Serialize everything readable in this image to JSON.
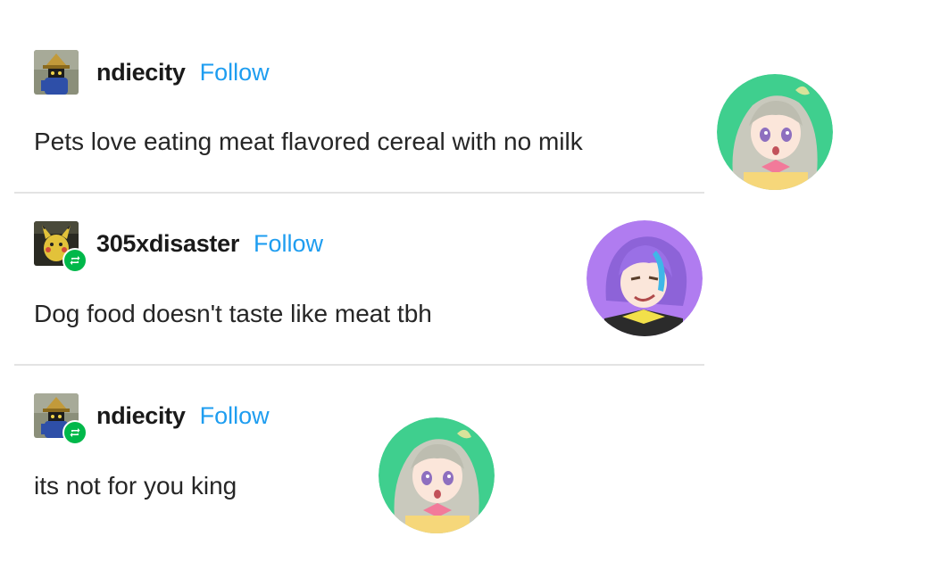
{
  "posts": [
    {
      "username": "ndiecity",
      "follow_label": "Follow",
      "text": "Pets love eating meat flavored cereal with no milk",
      "avatar": "black-mage-avatar",
      "reblog": false
    },
    {
      "username": "305xdisaster",
      "follow_label": "Follow",
      "text": "Dog food doesn't taste like meat tbh",
      "avatar": "pikachu-plush-avatar",
      "reblog": true
    },
    {
      "username": "ndiecity",
      "follow_label": "Follow",
      "text": "its not for you king",
      "avatar": "black-mage-avatar",
      "reblog": true
    }
  ],
  "stickers": [
    {
      "name": "anime-girl-green-sticker",
      "bg": "#3fcf8e"
    },
    {
      "name": "anime-boy-purple-sticker",
      "bg": "#b07cf0"
    },
    {
      "name": "anime-girl-green-sticker",
      "bg": "#3fcf8e"
    }
  ],
  "colors": {
    "follow": "#1e9df0",
    "reblog_badge": "#00b84a",
    "divider": "#e3e3e3"
  }
}
